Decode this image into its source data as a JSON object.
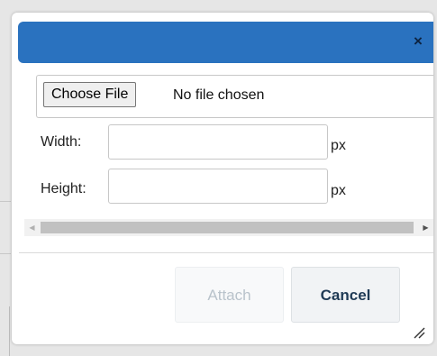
{
  "dialog": {
    "title": "",
    "close_label": "×"
  },
  "file_input": {
    "button_label": "Choose File",
    "status": "No file chosen"
  },
  "fields": {
    "width": {
      "label": "Width:",
      "value": "",
      "unit": "px"
    },
    "height": {
      "label": "Height:",
      "value": "",
      "unit": "px"
    }
  },
  "footer": {
    "attach_label": "Attach",
    "cancel_label": "Cancel"
  },
  "colors": {
    "titlebar": "#2a72bf",
    "attach_disabled_text": "#b9c3cb",
    "cancel_text": "#1f3a55"
  }
}
